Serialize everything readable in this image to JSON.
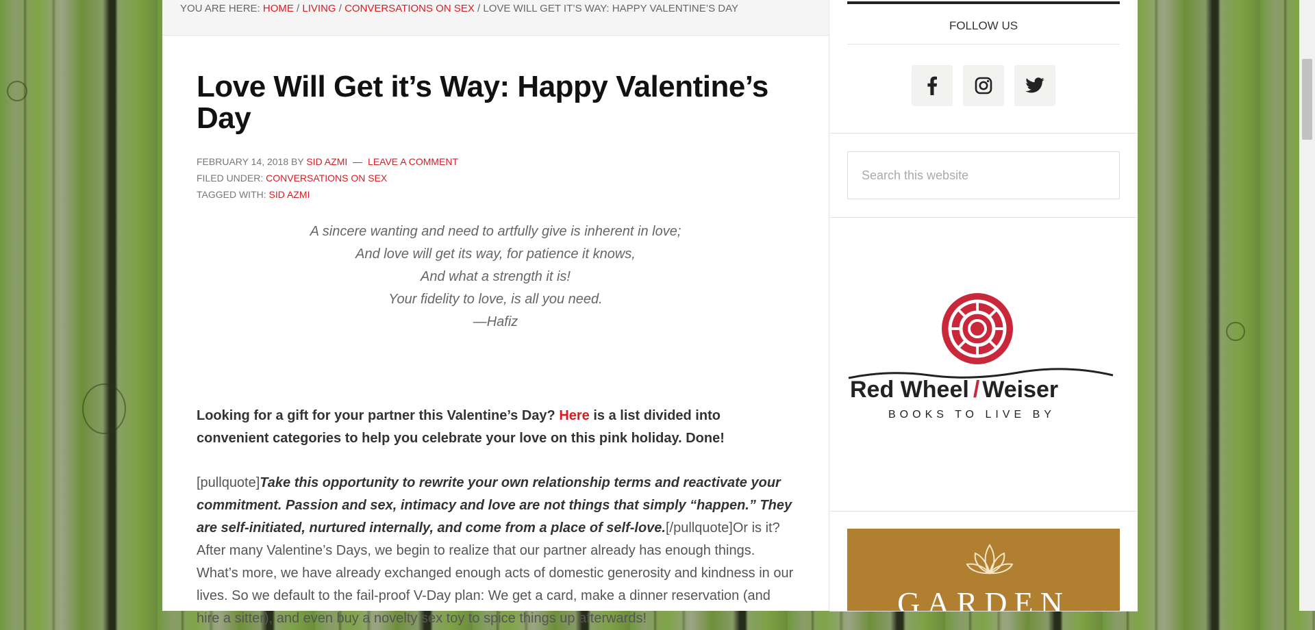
{
  "breadcrumb": {
    "prefix": "You are here:",
    "home": "Home",
    "living": "Living",
    "category": "Conversations on Sex",
    "current": "Love Will Get it’s Way: Happy Valentine’s Day",
    "sep": "/"
  },
  "post": {
    "title": "Love Will Get it’s Way: Happy Valentine’s Day",
    "date": "February 14, 2018",
    "by": "by",
    "author": "Sid Azmi",
    "dash": "—",
    "comment_link": "Leave a Comment",
    "filed_label": "Filed Under:",
    "filed_value": "Conversations on Sex",
    "tagged_label": "Tagged With:",
    "tagged_value": "Sid Azmi",
    "poem": [
      "A sincere wanting and need to artfully give is inherent in love;",
      "And love will get its way, for patience it knows,",
      "And what a strength it is!",
      "Your fidelity to love, is all you need.",
      "—Hafiz"
    ],
    "intro_before": "Looking for a gift for your partner this Valentine’s Day? ",
    "intro_link": "Here",
    "intro_after": " is a list divided into convenient categories to help you celebrate your love on this pink holiday. Done!",
    "pq_open": "[pullquote]",
    "pq_text": "Take this opportunity to rewrite your own relationship terms and reactivate your commitment. Passion and sex, intimacy and love are not things that simply “happen.” They are self-initiated, nurtured internally, and come from a place of self-love.",
    "pq_close_and_rest": "[/pullquote]Or is it? After many Valentine’s Days, we begin to realize that our partner already has enough things. What’s more, we have already exchanged enough acts of domestic generosity and kindness in our lives. So we default to the fail-proof V-Day plan: We get a card, make a dinner reservation (and hire a sitter), and even buy a novelty sex toy to spice things up afterwards!"
  },
  "sidebar": {
    "follow_title": "Follow Us",
    "social": [
      "facebook-icon",
      "instagram-icon",
      "twitter-icon"
    ],
    "search_placeholder": "Search this website",
    "ad_brand": "Red Wheel",
    "ad_slash": "/",
    "ad_brand2": "Weiser",
    "ad_tagline": "BOOKS TO LIVE BY",
    "garden_text": "GARDEN"
  },
  "colors": {
    "accent": "#d81c23",
    "garden": "#b07f30"
  }
}
